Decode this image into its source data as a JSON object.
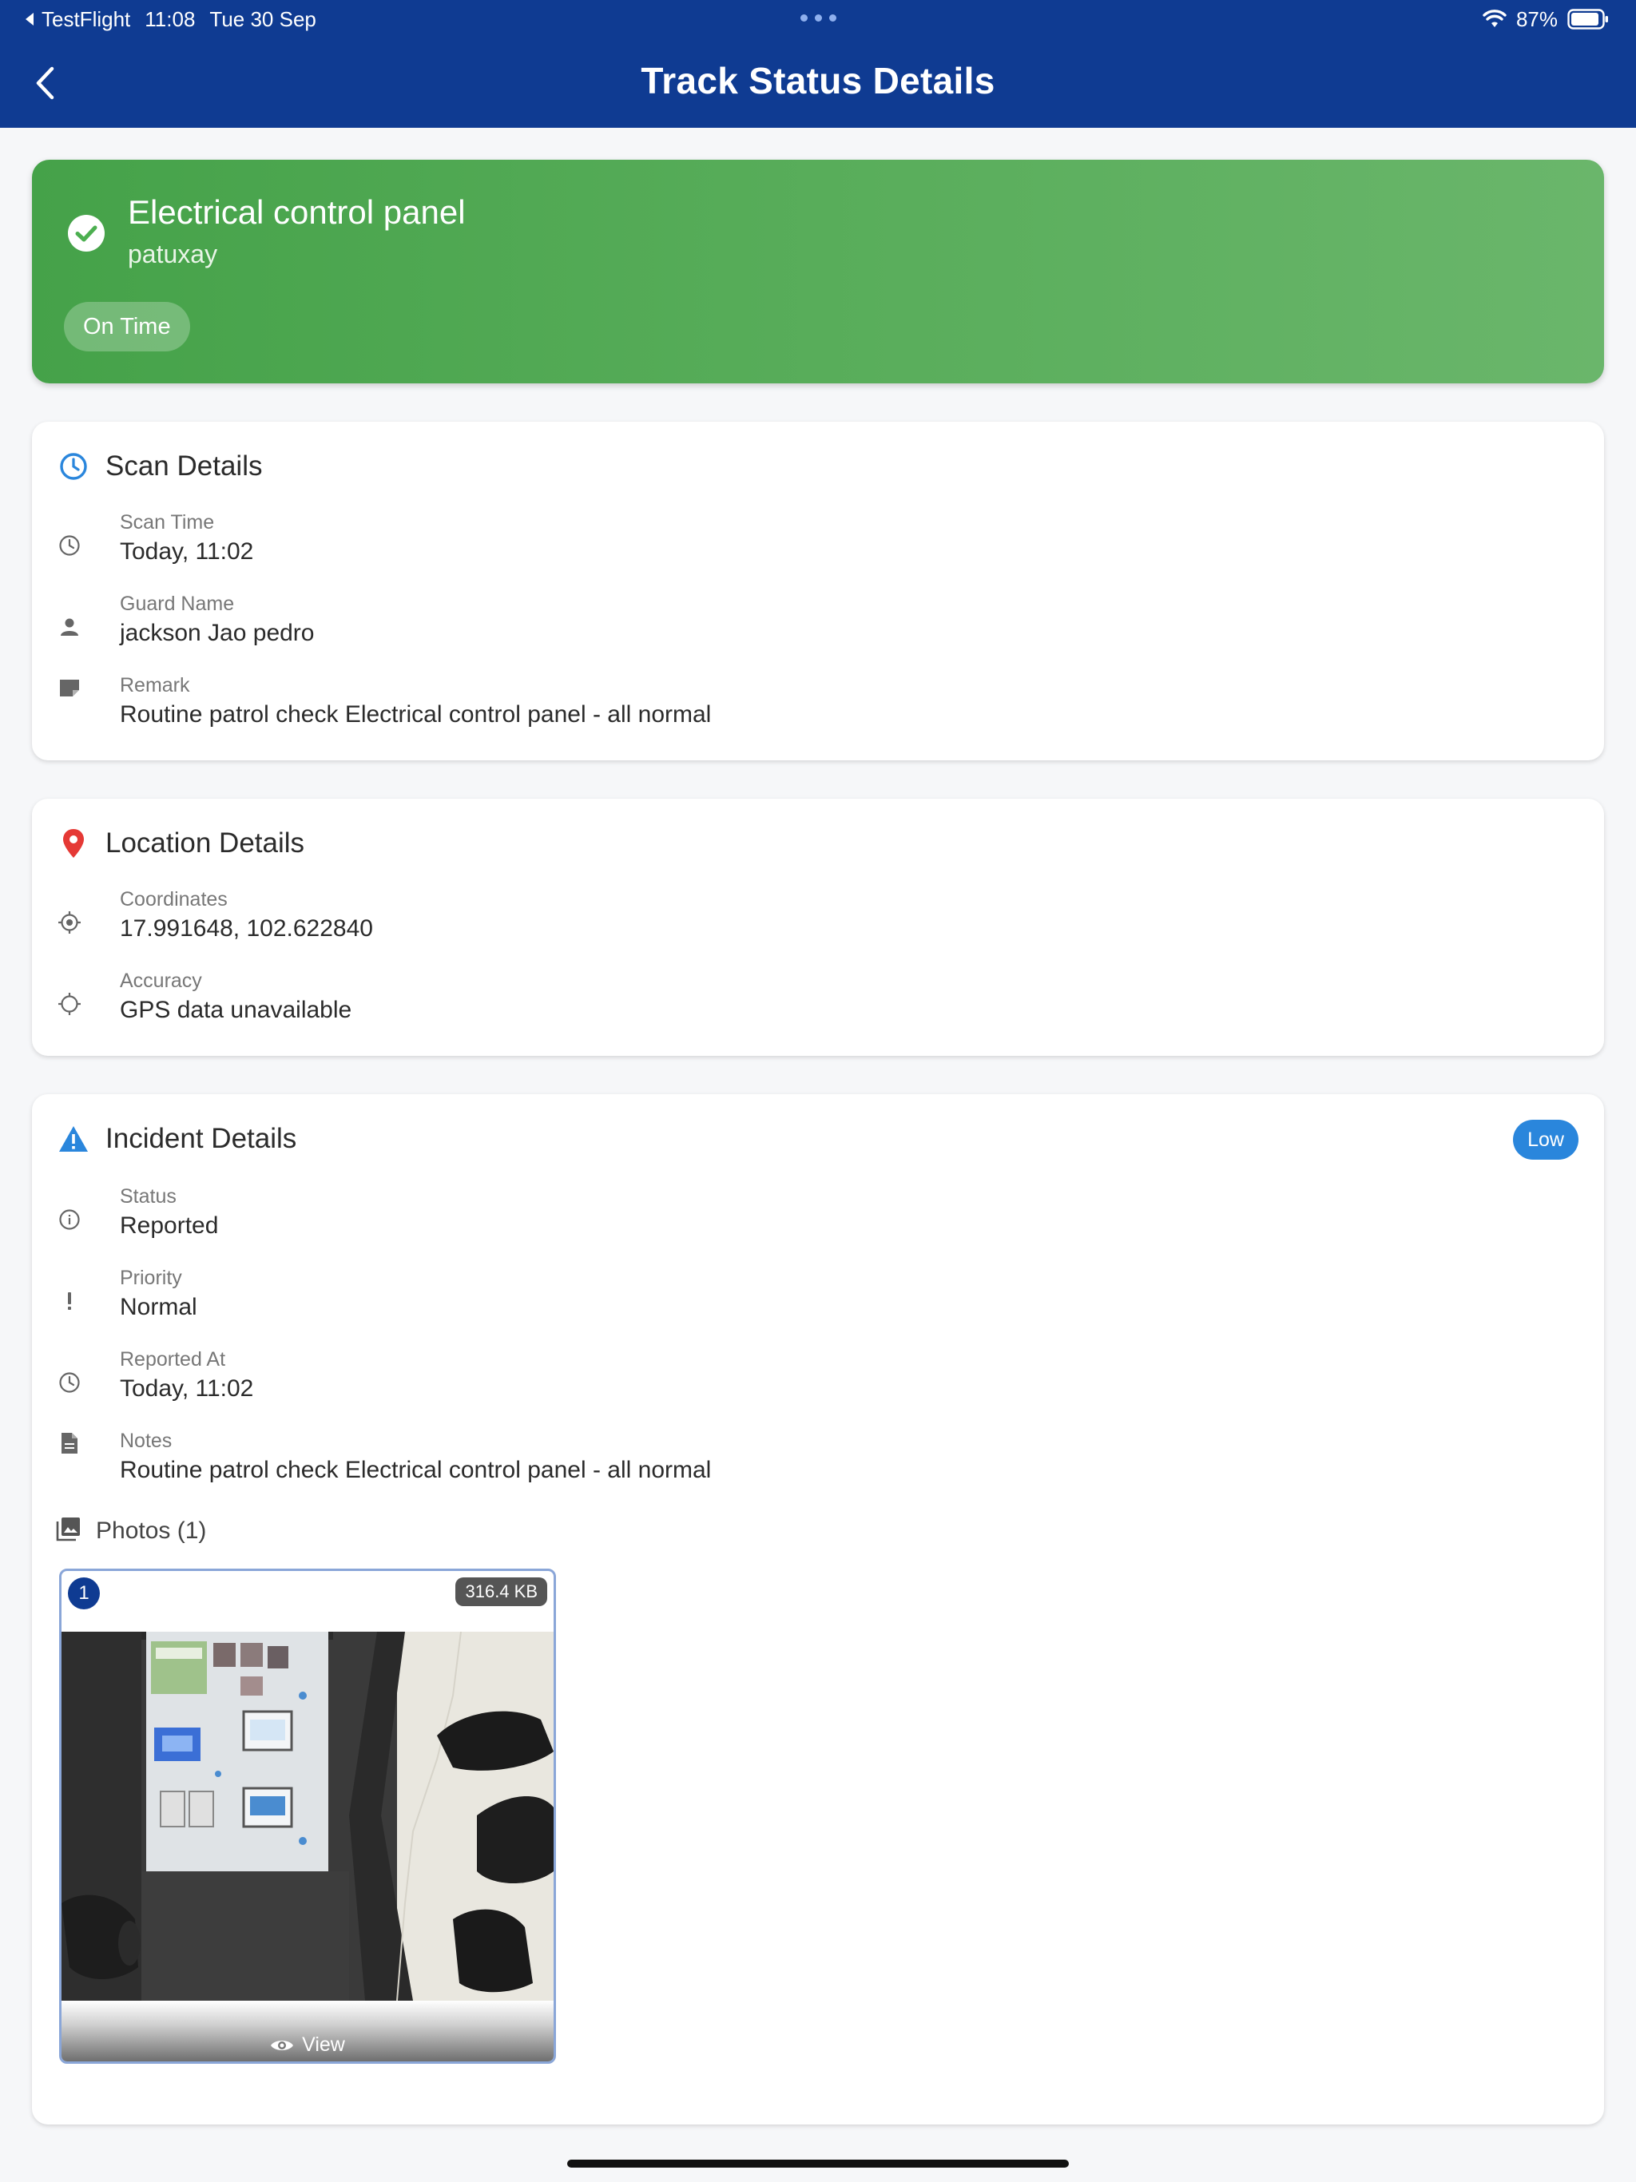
{
  "status_bar": {
    "back_app": "TestFlight",
    "time": "11:08",
    "date": "Tue 30 Sep",
    "battery": "87%"
  },
  "header": {
    "title": "Track Status Details"
  },
  "hero": {
    "title": "Electrical control panel",
    "subtitle": "patuxay",
    "status_pill": "On Time",
    "icon": "check-circle-icon",
    "color": "#4caf50"
  },
  "scan_details": {
    "title": "Scan Details",
    "icon": "clock-icon",
    "rows": [
      {
        "label": "Scan Time",
        "value": "Today, 11:02",
        "icon": "clock-icon"
      },
      {
        "label": "Guard Name",
        "value": "jackson Jao pedro",
        "icon": "person-icon"
      },
      {
        "label": "Remark",
        "value": "Routine patrol check Electrical control panel - all normal",
        "icon": "note-icon"
      }
    ]
  },
  "location_details": {
    "title": "Location Details",
    "icon": "map-pin-icon",
    "rows": [
      {
        "label": "Coordinates",
        "value": "17.991648, 102.622840",
        "icon": "my-location-icon"
      },
      {
        "label": "Accuracy",
        "value": "GPS data unavailable",
        "icon": "crosshair-icon"
      }
    ]
  },
  "incident_details": {
    "title": "Incident Details",
    "icon": "warning-icon",
    "severity_badge": "Low",
    "severity_color": "#2a86dc",
    "rows": [
      {
        "label": "Status",
        "value": "Reported",
        "icon": "info-icon"
      },
      {
        "label": "Priority",
        "value": "Normal",
        "icon": "exclamation-icon"
      },
      {
        "label": "Reported At",
        "value": "Today, 11:02",
        "icon": "clock-icon"
      },
      {
        "label": "Notes",
        "value": "Routine patrol check Electrical control panel - all normal",
        "icon": "document-icon"
      }
    ],
    "photos": {
      "title": "Photos (1)",
      "icon": "photo-library-icon",
      "items": [
        {
          "index": "1",
          "size": "316.4 KB",
          "action": "View"
        }
      ]
    }
  },
  "colors": {
    "header_bg": "#0f3b92",
    "accent_blue": "#2a86dc",
    "pin_red": "#e53935",
    "success_green": "#4caf50"
  }
}
